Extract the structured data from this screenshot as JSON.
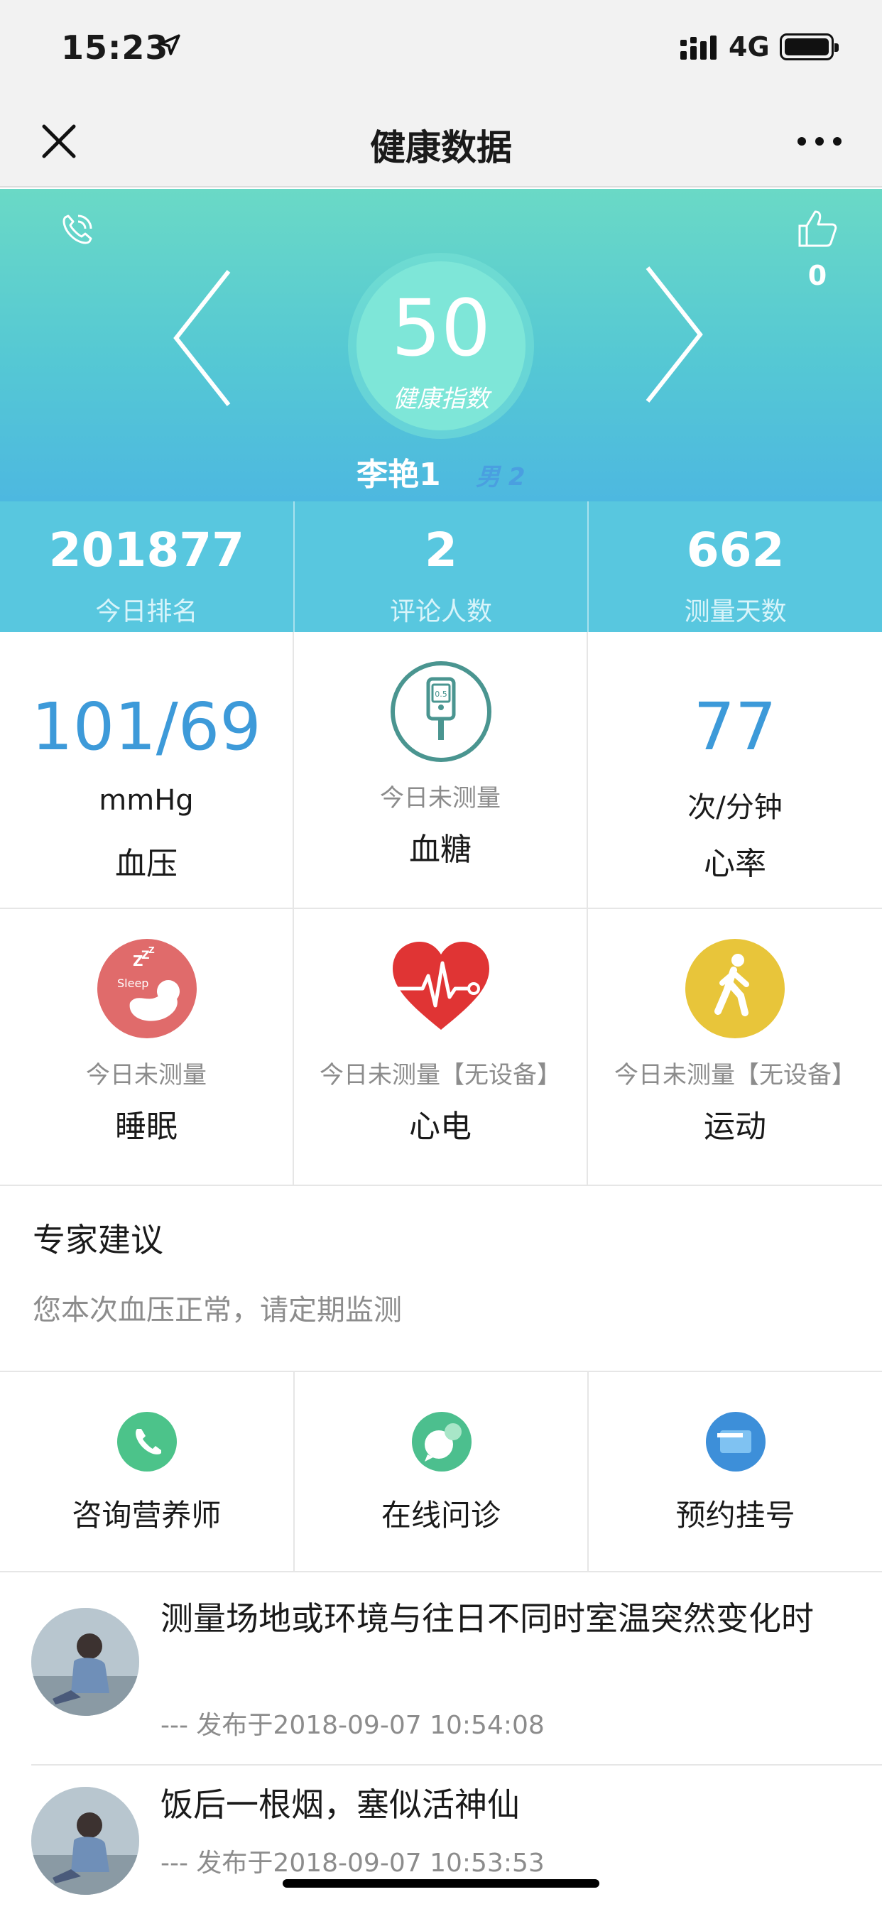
{
  "status_bar": {
    "time": "15:23",
    "network": "4G"
  },
  "nav": {
    "title": "健康数据"
  },
  "hero": {
    "likes": "0",
    "score": "50",
    "score_label": "健康指数",
    "name": "李艳1",
    "gender": "男 2"
  },
  "stats": [
    {
      "value": "201877",
      "label": "今日排名"
    },
    {
      "value": "2",
      "label": "评论人数"
    },
    {
      "value": "662",
      "label": "测量天数"
    }
  ],
  "metrics": {
    "blood_pressure": {
      "value": "101/69",
      "unit": "mmHg",
      "name": "血压"
    },
    "blood_sugar": {
      "status": "今日未测量",
      "name": "血糖",
      "icon": "glucose-meter-icon"
    },
    "heart_rate": {
      "value": "77",
      "unit": "次/分钟",
      "name": "心率"
    },
    "sleep": {
      "status": "今日未测量",
      "name": "睡眠",
      "icon": "sleep-icon",
      "icon_text": "Sleep"
    },
    "ecg": {
      "status": "今日未测量【无设备】",
      "name": "心电",
      "icon": "ecg-heart-icon"
    },
    "exercise": {
      "status": "今日未测量【无设备】",
      "name": "运动",
      "icon": "walking-icon"
    }
  },
  "advice": {
    "title": "专家建议",
    "text": "您本次血压正常，请定期监测"
  },
  "services": [
    {
      "label": "咨询营养师",
      "icon": "phone-icon"
    },
    {
      "label": "在线问诊",
      "icon": "chat-icon"
    },
    {
      "label": "预约挂号",
      "icon": "card-icon"
    }
  ],
  "articles": [
    {
      "title": "测量场地或环境与往日不同时室温突然变化时",
      "date": "--- 发布于2018-09-07 10:54:08"
    },
    {
      "title": "饭后一根烟，塞似活神仙",
      "date": "--- 发布于2018-09-07 10:53:53"
    }
  ],
  "colors": {
    "accent_blue": "#3d9ad9",
    "stats_bg": "#58c7df",
    "sleep_icon": "#e06b6b",
    "ecg_icon": "#e03434",
    "exercise_icon": "#e8c53a",
    "glucose_icon": "#4a9590"
  }
}
